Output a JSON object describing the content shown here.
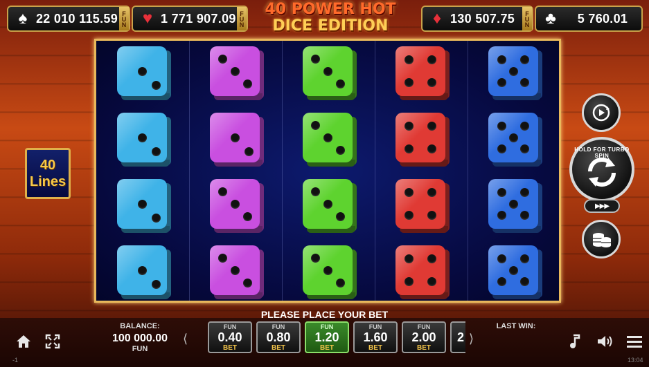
{
  "jackpots": {
    "spades": "22 010 115.59",
    "hearts": "1 771 907.09",
    "diamonds": "130 507.75",
    "clubs": "5 760.01",
    "fun_tag": "FUN"
  },
  "title": {
    "line1": "40 POWER HOT",
    "line2": "DICE EDITION"
  },
  "lines": {
    "count": "40",
    "label": "Lines"
  },
  "reels": [
    {
      "color": "#3fb3e8",
      "values": [
        2,
        2,
        2,
        2
      ]
    },
    {
      "color": "#c94fe0",
      "values": [
        3,
        2,
        3,
        3
      ]
    },
    {
      "color": "#5ed32f",
      "values": [
        3,
        3,
        3,
        3
      ]
    },
    {
      "color": "#e03a34",
      "values": [
        4,
        4,
        4,
        4
      ]
    },
    {
      "color": "#2f6de0",
      "values": [
        5,
        5,
        5,
        5
      ]
    }
  ],
  "spin": {
    "hold_text": "HOLD FOR TURBO SPIN",
    "turbo_glyph": "▶▶▶"
  },
  "message": "PLEASE PLACE YOUR BET",
  "balance": {
    "label": "BALANCE:",
    "value": "100 000.00",
    "currency": "FUN"
  },
  "bets": [
    {
      "top": "FUN",
      "value": "0.40",
      "bottom": "BET",
      "selected": false
    },
    {
      "top": "FUN",
      "value": "0.80",
      "bottom": "BET",
      "selected": false
    },
    {
      "top": "FUN",
      "value": "1.20",
      "bottom": "BET",
      "selected": true
    },
    {
      "top": "FUN",
      "value": "1.60",
      "bottom": "BET",
      "selected": false
    },
    {
      "top": "FUN",
      "value": "2.00",
      "bottom": "BET",
      "selected": false
    }
  ],
  "bet_partial": "2",
  "last_win": {
    "label": "LAST WIN:"
  },
  "status": {
    "left": "-1",
    "right": "13:04"
  },
  "icons": {
    "home": "home-icon",
    "fullscreen": "fullscreen-icon",
    "music": "music-icon",
    "sound": "sound-icon",
    "menu": "menu-icon",
    "autoplay": "autoplay-icon",
    "coins": "coins-icon"
  }
}
